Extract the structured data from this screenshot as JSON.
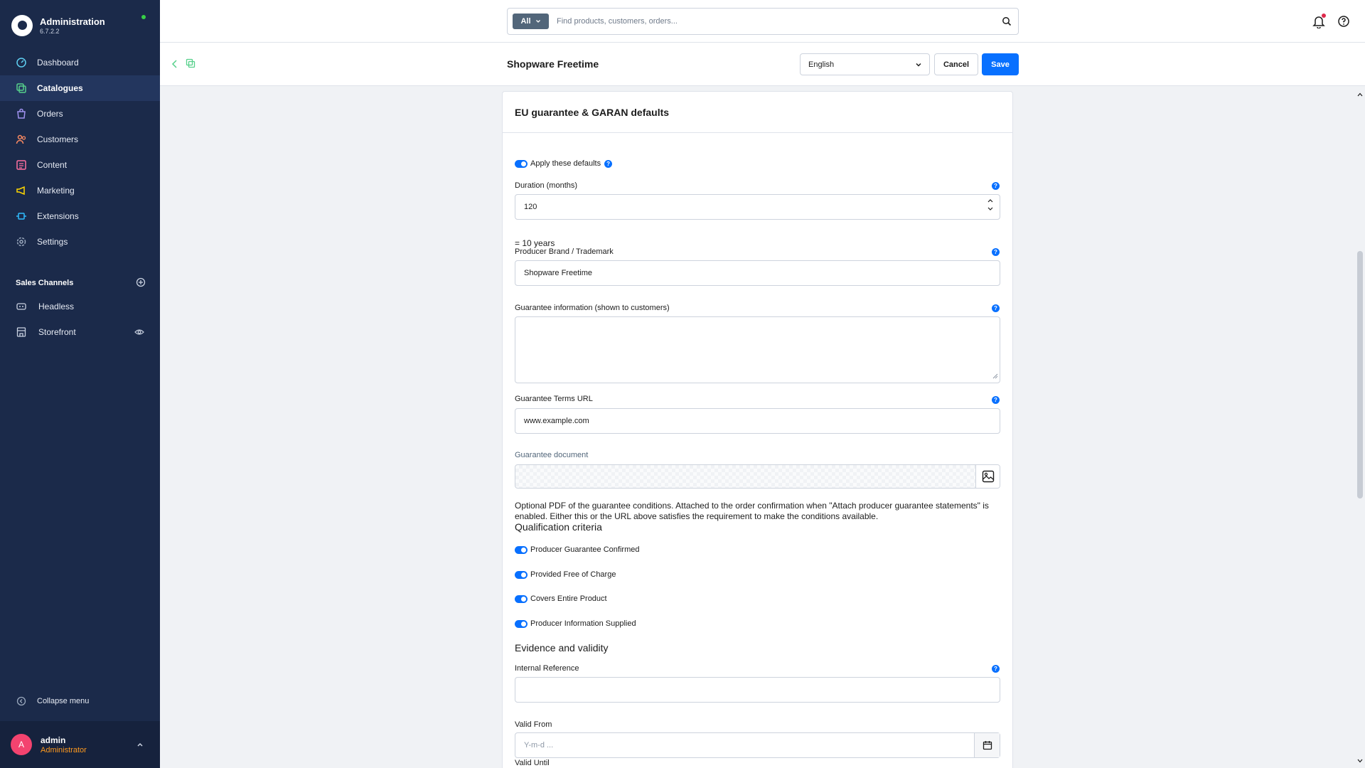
{
  "sidebar": {
    "brand": {
      "title": "Administration",
      "version": "6.7.2.2"
    },
    "nav": [
      {
        "label": "Dashboard",
        "icon": "dashboard-icon",
        "color": "#5fd0f2",
        "active": false
      },
      {
        "label": "Catalogues",
        "icon": "catalogues-icon",
        "color": "#56d08b",
        "active": true
      },
      {
        "label": "Orders",
        "icon": "orders-icon",
        "color": "#a092f0",
        "active": false
      },
      {
        "label": "Customers",
        "icon": "customers-icon",
        "color": "#f88962",
        "active": false
      },
      {
        "label": "Content",
        "icon": "content-icon",
        "color": "#ff6fa0",
        "active": false
      },
      {
        "label": "Marketing",
        "icon": "marketing-icon",
        "color": "#ffd700",
        "active": false
      },
      {
        "label": "Extensions",
        "icon": "extensions-icon",
        "color": "#2fbcff",
        "active": false
      },
      {
        "label": "Settings",
        "icon": "settings-icon",
        "color": "#9aa8bd",
        "active": false
      }
    ],
    "sales_channels": {
      "heading": "Sales Channels",
      "items": [
        {
          "label": "Headless",
          "icon": "headless-icon"
        },
        {
          "label": "Storefront",
          "icon": "storefront-icon"
        }
      ]
    },
    "collapse_label": "Collapse menu",
    "user": {
      "initial": "A",
      "name": "admin",
      "role": "Administrator"
    }
  },
  "search": {
    "type_label": "All",
    "placeholder": "Find products, customers, orders..."
  },
  "page": {
    "title": "Shopware Freetime",
    "language": "English",
    "cancel_label": "Cancel",
    "save_label": "Save"
  },
  "card": {
    "title": "EU guarantee & GARAN defaults",
    "apply_defaults": {
      "label": "Apply these defaults",
      "checked": true
    },
    "duration": {
      "label": "Duration (months)",
      "value": "120",
      "hint": "= 10 years"
    },
    "brand": {
      "label": "Producer Brand / Trademark",
      "value": "Shopware Freetime"
    },
    "guarantee_info": {
      "label": "Guarantee information (shown to customers)",
      "value": ""
    },
    "terms_url": {
      "label": "Guarantee Terms URL",
      "value": "www.example.com"
    },
    "document": {
      "label": "Guarantee document",
      "help": "Optional PDF of the guarantee conditions. Attached to the order confirmation when \"Attach producer guarantee statements\" is enabled. Either this or the URL above satisfies the requirement to make the conditions available."
    },
    "qualification": {
      "heading": "Qualification criteria",
      "items": [
        {
          "label": "Producer Guarantee Confirmed",
          "checked": true
        },
        {
          "label": "Provided Free of Charge",
          "checked": true
        },
        {
          "label": "Covers Entire Product",
          "checked": true
        },
        {
          "label": "Producer Information Supplied",
          "checked": true
        }
      ]
    },
    "evidence": {
      "heading": "Evidence and validity",
      "internal_reference": {
        "label": "Internal Reference",
        "value": ""
      },
      "valid_from": {
        "label": "Valid From",
        "placeholder": "Y-m-d ..."
      },
      "valid_until": {
        "label": "Valid Until"
      }
    }
  }
}
